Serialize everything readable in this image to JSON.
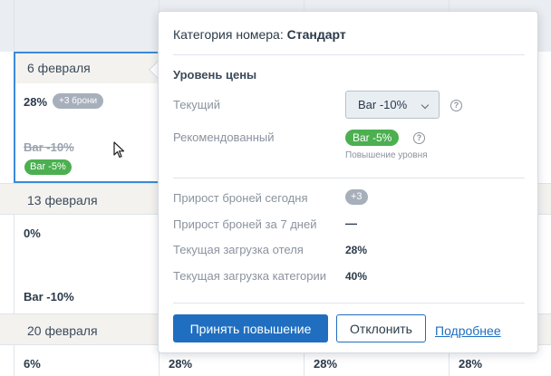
{
  "calendar": {
    "weeks": [
      {
        "date": "6 февраля",
        "occupancy": "28%",
        "bookings_badge": "+3 брони",
        "old_rate": "Bar -10%",
        "new_rate": "Bar -5%"
      },
      {
        "date": "13 февраля",
        "occupancy": "0%",
        "rate": "Bar -10%"
      },
      {
        "date": "20 февраля",
        "occupancy": "6%",
        "other_columns_occupancy": [
          "28%",
          "28%",
          "28%"
        ]
      }
    ]
  },
  "popover": {
    "title_prefix": "Категория номера:",
    "title_value": "Стандарт",
    "price_section": {
      "title": "Уровень цены",
      "current_label": "Текущий",
      "current_value": "Bar -10%",
      "recommended_label": "Рекомендованный",
      "recommended_value": "Bar -5%",
      "recommended_note": "Повышение уровня"
    },
    "stats": {
      "bookings_today_label": "Прирост броней сегодня",
      "bookings_today_value": "+3",
      "bookings_week_label": "Прирост броней за 7 дней",
      "bookings_week_value": "—",
      "hotel_load_label": "Текущая загрузка отеля",
      "hotel_load_value": "28%",
      "category_load_label": "Текущая загрузка категории",
      "category_load_value": "40%"
    },
    "actions": {
      "accept": "Принять повышение",
      "decline": "Отклонить",
      "details": "Подробнее"
    }
  },
  "colors": {
    "accent": "#1f6ec0",
    "selection": "#3b8ad9",
    "green": "#4caf50",
    "gray_pill": "#a7afbb"
  },
  "icons": {
    "help": "question-circle-icon",
    "dropdown": "chevron-down-icon",
    "cursor": "mouse-pointer-icon"
  }
}
